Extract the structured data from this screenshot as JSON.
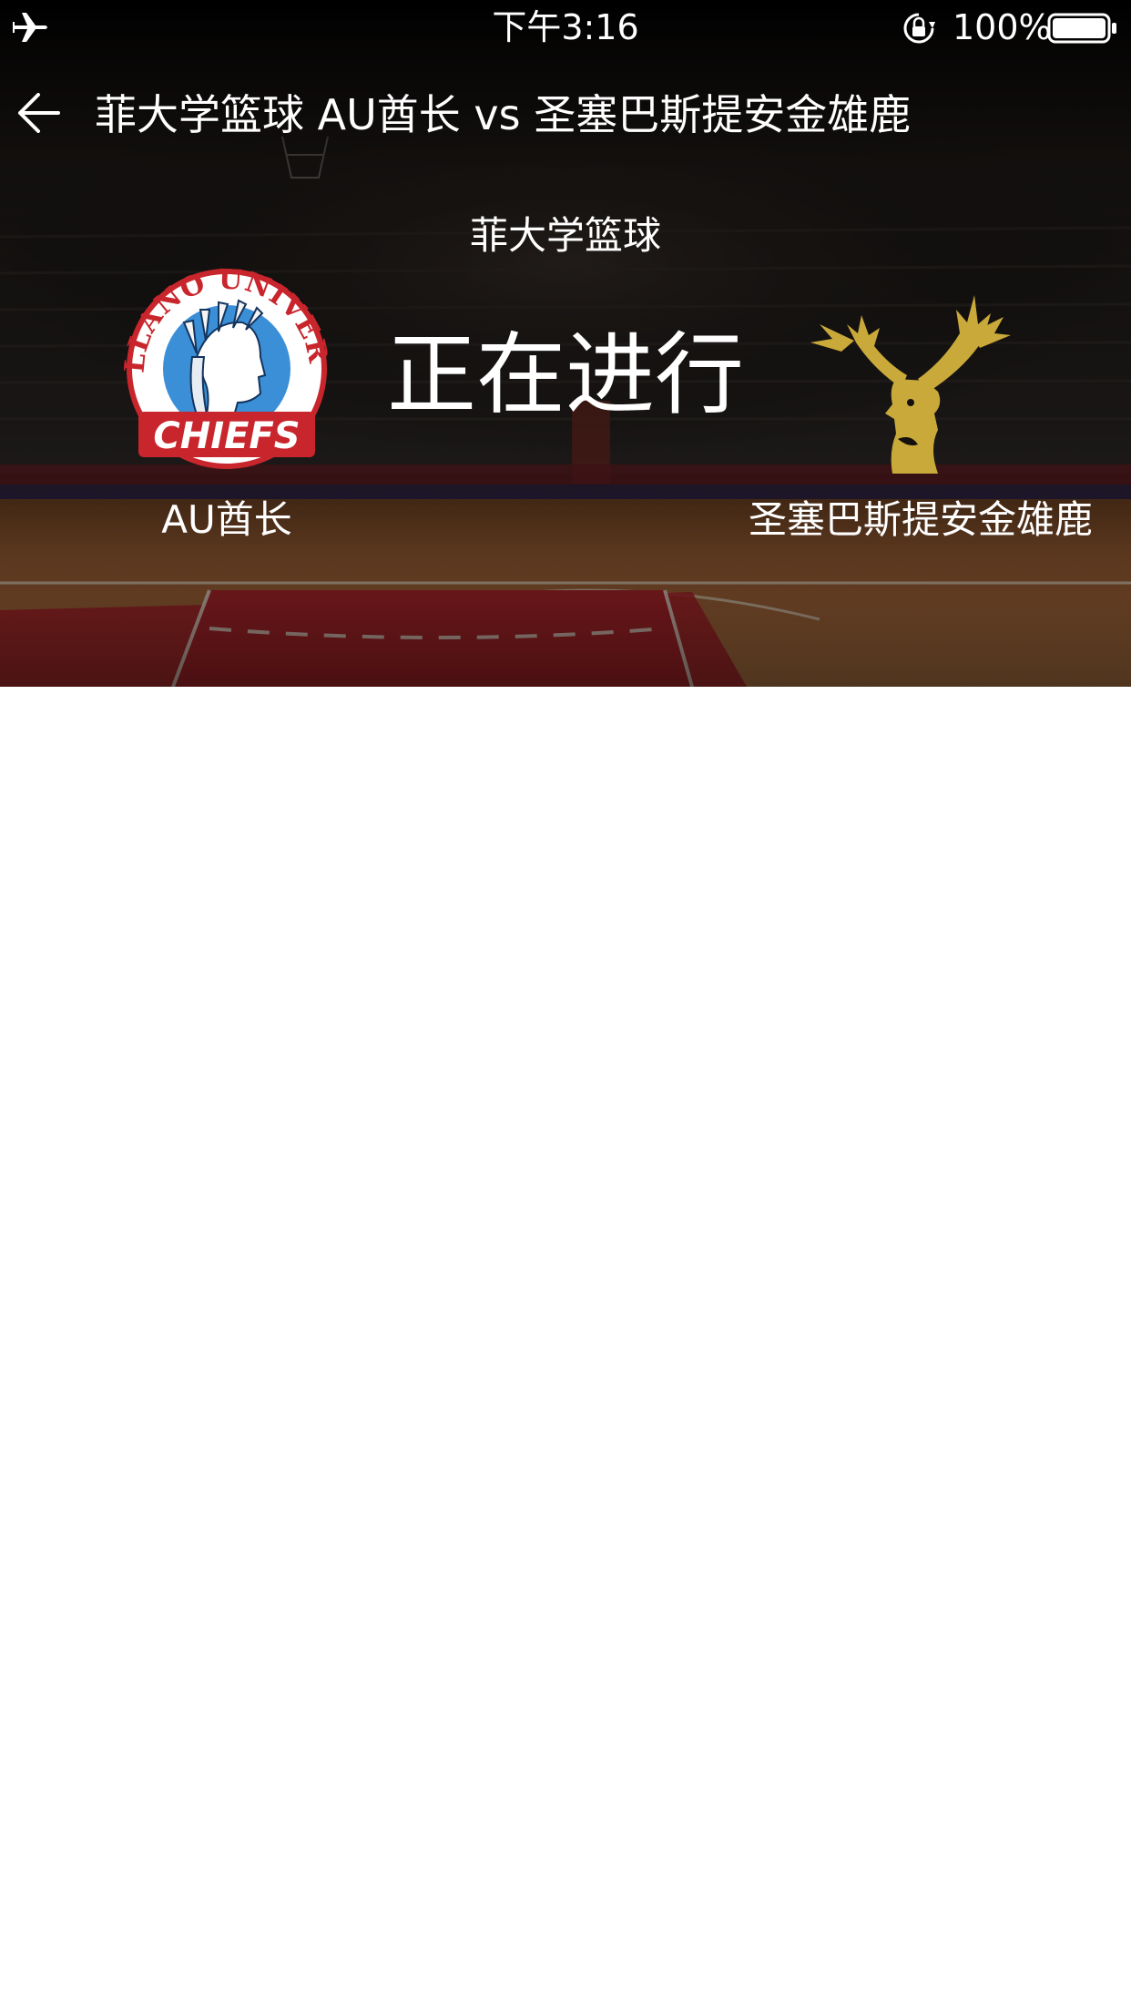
{
  "status_bar": {
    "time": "下午3:16",
    "battery_percent": "100%",
    "icons": [
      "airplane-icon",
      "orientation-lock-icon",
      "battery-icon"
    ]
  },
  "nav": {
    "back_icon": "arrow-left-icon",
    "title": "菲大学篮球  AU酋长 vs 圣塞巴斯提安金雄鹿"
  },
  "match": {
    "league": "菲大学篮球",
    "status": "正在进行",
    "home_team": {
      "name": "AU酋长",
      "logo": "arellano-university-chiefs-logo",
      "logo_text_top": "ARELLANO UNIVERSITY",
      "logo_text_bottom": "CHIEFS"
    },
    "away_team": {
      "name": "圣塞巴斯提安金雄鹿",
      "logo": "golden-stag-logo"
    }
  },
  "colors": {
    "hero_dark": "#14100e",
    "court_wood": "#a8683a",
    "court_red": "#b3262b",
    "home_logo_red": "#c8262c",
    "home_logo_blue": "#3a8fd6",
    "away_logo_gold": "#c9a93a"
  }
}
